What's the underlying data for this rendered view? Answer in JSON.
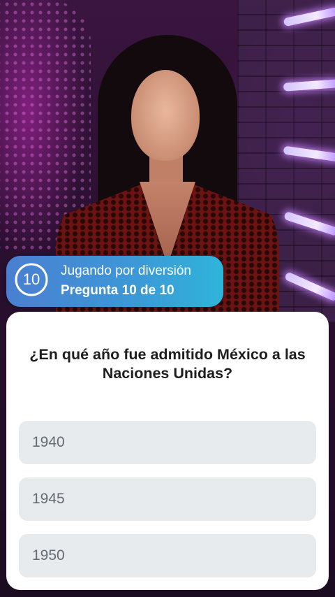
{
  "status": {
    "counter": "10",
    "mode_label": "Jugando por diversión",
    "progress_label": "Pregunta 10 de 10"
  },
  "quiz": {
    "question": "¿En qué año fue admitido México a las Naciones Unidas?",
    "options": [
      {
        "label": "1940"
      },
      {
        "label": "1945"
      },
      {
        "label": "1950"
      }
    ]
  },
  "colors": {
    "pill_gradient_start": "#4a7fd2",
    "pill_gradient_end": "#2fb4da",
    "option_background": "#e8ebee",
    "option_text": "#636c74",
    "question_text": "#1e1e1e"
  }
}
